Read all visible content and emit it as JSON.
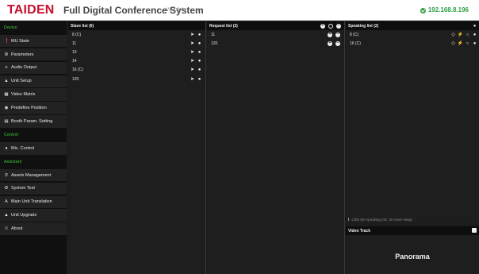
{
  "header": {
    "brand": "TAIDEN",
    "title": "Full Digital Conference System",
    "version": "V1.2.0.4",
    "ip": "192.168.8.196"
  },
  "sidebar": {
    "items": [
      {
        "label": "Device",
        "section": true,
        "icon": ""
      },
      {
        "label": "MU State",
        "icon": "info-icon"
      },
      {
        "label": "Parameters",
        "icon": "settings-icon"
      },
      {
        "label": "Audio Output",
        "icon": "sliders-icon"
      },
      {
        "label": "Unit Setup",
        "icon": "speaker-icon"
      },
      {
        "label": "Video Matrix",
        "icon": "grid-icon"
      },
      {
        "label": "Predefine Position",
        "icon": "camera-icon"
      },
      {
        "label": "Booth Param. Setting",
        "icon": "booth-icon"
      },
      {
        "label": "Control",
        "section": true,
        "icon": ""
      },
      {
        "label": "Mic. Control",
        "icon": "mic-icon"
      },
      {
        "label": "Assistant",
        "section": true,
        "icon": ""
      },
      {
        "label": "Assets Management",
        "icon": "location-icon"
      },
      {
        "label": "System Test",
        "icon": "gear-icon"
      },
      {
        "label": "Main Unit Translation",
        "icon": "translate-icon"
      },
      {
        "label": "Unit Upgrade",
        "icon": "user-icon"
      },
      {
        "label": "About",
        "icon": "about-icon"
      }
    ]
  },
  "slave_list": {
    "title": "Slave list (6)",
    "rows": [
      "8 (C)",
      "11",
      "13",
      "14",
      "16 (C)",
      "120"
    ]
  },
  "request_list": {
    "title": "Request list (2)",
    "rows": [
      "11",
      "120"
    ]
  },
  "speaking_list": {
    "title": "Speaking list (2)",
    "rows": [
      "8 (C)",
      "16 (C)"
    ],
    "hint": "Click the speaking mic. for more setup."
  },
  "video_track": {
    "title": "Video Track",
    "mode": "Panorama"
  },
  "colors": {
    "brand": "#c8102e",
    "status_ok": "#2ea043",
    "section_label": "#3ec43e",
    "background": "#1c1c1c"
  }
}
